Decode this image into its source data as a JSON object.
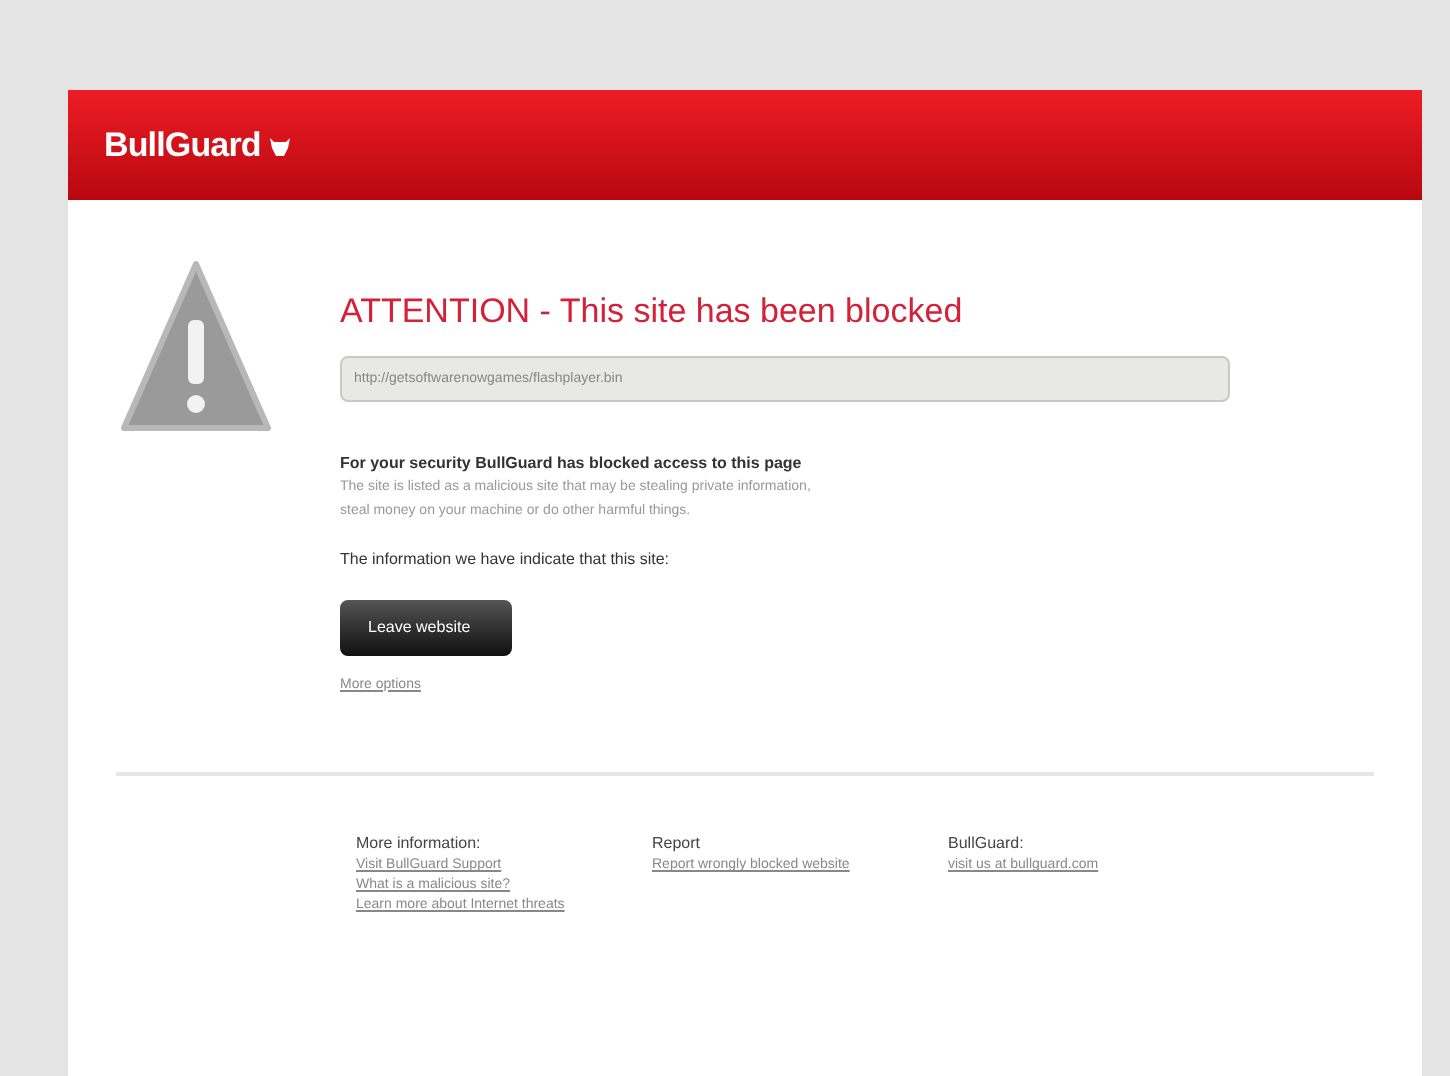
{
  "header": {
    "logo": "BullGuard"
  },
  "title": "ATTENTION - This site has been blocked",
  "url_field": {
    "value": "http://getsoftwarenowgames/flashplayer.bin"
  },
  "notice": {
    "heading": "For your security BullGuard has blocked access to this page",
    "lines": [
      "The site is listed as a malicious site that may be stealing private information,",
      "steal money on your machine or do other harmful things."
    ]
  },
  "info_text": "The information we have indicate that this site:",
  "leave_button": "Leave website",
  "more_options": "More options",
  "footer": [
    {
      "heading": "More information:",
      "links": [
        "Visit BullGuard Support",
        "What is a malicious site?",
        "Learn more about Internet threats"
      ]
    },
    {
      "heading": "Report",
      "links": [
        "Report wrongly blocked website"
      ]
    },
    {
      "heading": "BullGuard:",
      "links": [
        "visit us at bullguard.com"
      ]
    }
  ]
}
